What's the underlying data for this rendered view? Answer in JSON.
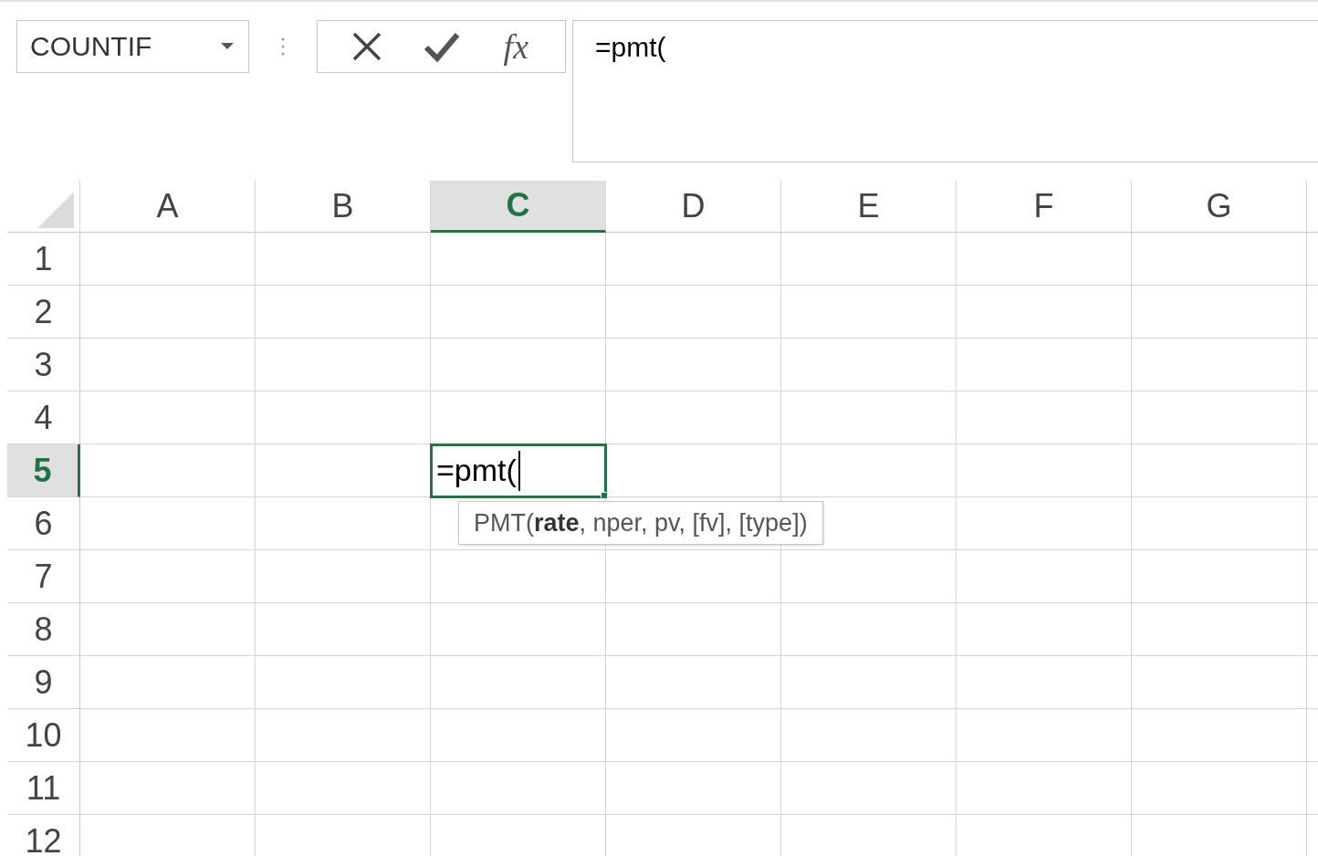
{
  "name_box": {
    "value": "COUNTIF"
  },
  "formula_buttons": [
    {
      "kind": "cancel"
    },
    {
      "kind": "enter"
    },
    {
      "kind": "function",
      "label": "fx"
    }
  ],
  "formula_bar": {
    "value": "=pmt("
  },
  "columns": [
    {
      "label": "A",
      "selected": false
    },
    {
      "label": "B",
      "selected": false
    },
    {
      "label": "C",
      "selected": true
    },
    {
      "label": "D",
      "selected": false
    },
    {
      "label": "E",
      "selected": false
    },
    {
      "label": "F",
      "selected": false
    },
    {
      "label": "G",
      "selected": false
    }
  ],
  "rows": [
    {
      "label": "1",
      "selected": false
    },
    {
      "label": "2",
      "selected": false
    },
    {
      "label": "3",
      "selected": false
    },
    {
      "label": "4",
      "selected": false
    },
    {
      "label": "5",
      "selected": true
    },
    {
      "label": "6",
      "selected": false
    },
    {
      "label": "7",
      "selected": false
    },
    {
      "label": "8",
      "selected": false
    },
    {
      "label": "9",
      "selected": false
    },
    {
      "label": "10",
      "selected": false
    },
    {
      "label": "11",
      "selected": false
    },
    {
      "label": "12",
      "selected": false
    }
  ],
  "active_cell": {
    "value": "=pmt("
  },
  "tooltip": {
    "text": "PMT(**rate**, nper, pv, [fv], [type])"
  }
}
